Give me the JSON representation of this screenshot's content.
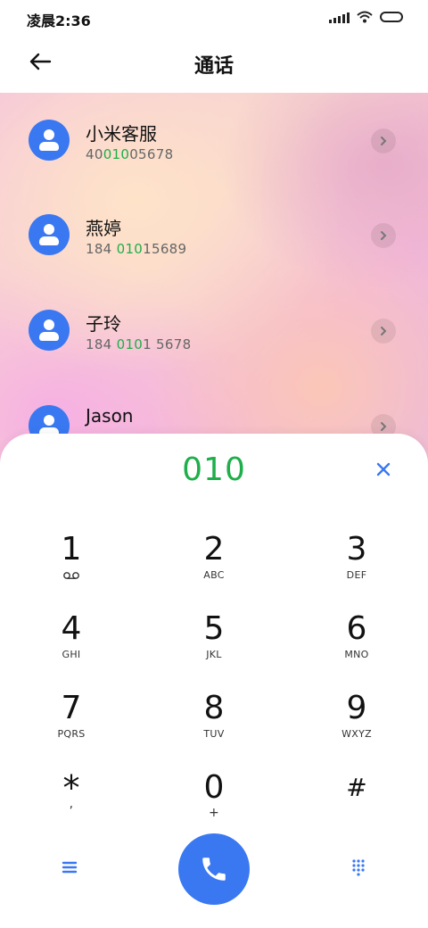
{
  "status_bar": {
    "time": "凌晨2:36"
  },
  "header": {
    "title": "通话"
  },
  "contacts": [
    {
      "name": "小米客服",
      "number_pre": "40",
      "number_match": "010",
      "number_post": "05678"
    },
    {
      "name": "燕婷",
      "number_pre": "184 ",
      "number_match": "010",
      "number_post": "15689"
    },
    {
      "name": "子玲",
      "number_pre": "184 ",
      "number_match": "010",
      "number_post": "1 5678"
    },
    {
      "name": "Jason",
      "number_pre": "",
      "number_match": "",
      "number_post": ""
    }
  ],
  "dialer": {
    "number": "010",
    "keys": [
      {
        "digit": "1",
        "letters": ""
      },
      {
        "digit": "2",
        "letters": "ABC"
      },
      {
        "digit": "3",
        "letters": "DEF"
      },
      {
        "digit": "4",
        "letters": "GHI"
      },
      {
        "digit": "5",
        "letters": "JKL"
      },
      {
        "digit": "6",
        "letters": "MNO"
      },
      {
        "digit": "7",
        "letters": "PQRS"
      },
      {
        "digit": "8",
        "letters": "TUV"
      },
      {
        "digit": "9",
        "letters": "WXYZ"
      },
      {
        "digit": "*",
        "letters": ","
      },
      {
        "digit": "0",
        "letters": "+"
      },
      {
        "digit": "#",
        "letters": ""
      }
    ]
  },
  "icons": {
    "back": "back-arrow-icon",
    "detail": "chevron-right-icon",
    "clear": "close-icon",
    "voicemail": "voicemail-icon",
    "menu": "menu-icon",
    "call": "phone-icon",
    "keypad": "keypad-icon"
  },
  "colors": {
    "accent": "#3a78f2",
    "match": "#1eae4a"
  }
}
